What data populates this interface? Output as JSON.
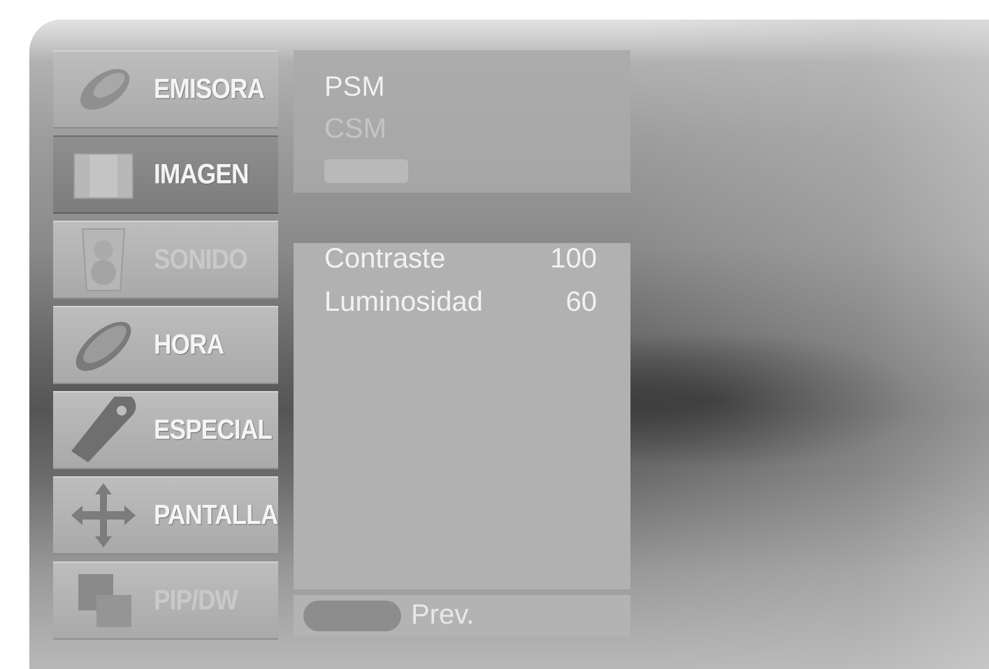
{
  "menu": {
    "items": [
      {
        "label": "EMISORA",
        "icon": "satellite-dish-icon"
      },
      {
        "label": "IMAGEN",
        "icon": "picture-icon",
        "active": true
      },
      {
        "label": "SONIDO",
        "icon": "speaker-icon"
      },
      {
        "label": "HORA",
        "icon": "clock-icon"
      },
      {
        "label": "ESPECIAL",
        "icon": "tag-icon"
      },
      {
        "label": "PANTALLA",
        "icon": "move-arrows-icon"
      },
      {
        "label": "PIP/DW",
        "icon": "pip-icon"
      }
    ]
  },
  "options": {
    "psm": "PSM",
    "csm": "CSM"
  },
  "settings": [
    {
      "name": "Contraste",
      "value": "100"
    },
    {
      "name": "Luminosidad",
      "value": "60"
    }
  ],
  "footer": {
    "prev_label": "Prev."
  },
  "colors": {
    "panel": "#b2b2b2",
    "active_item": "#8a8a8a",
    "text": "#f2f2f2"
  }
}
